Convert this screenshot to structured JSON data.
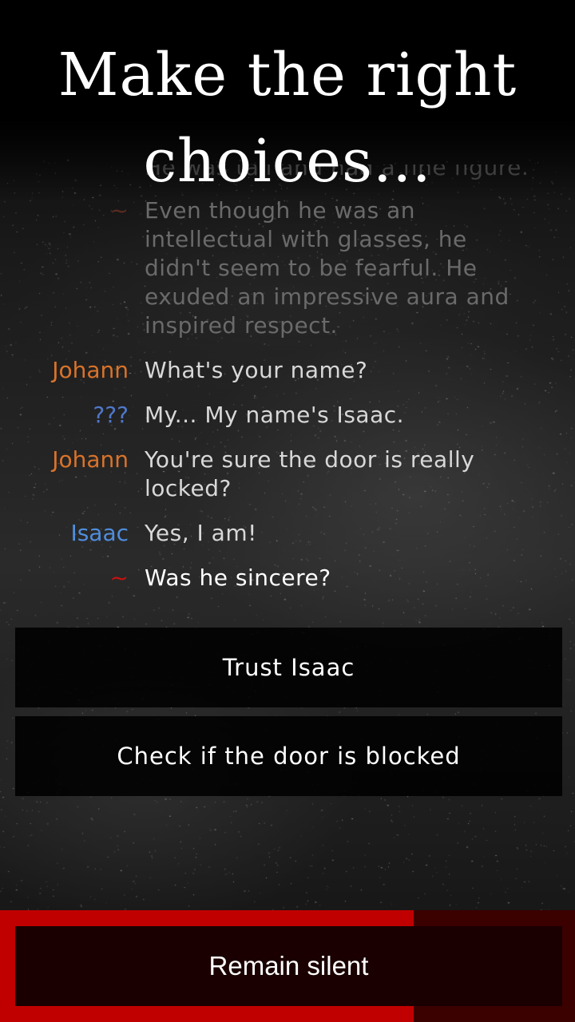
{
  "headline": {
    "line1": "Make the right",
    "line2": "choices..."
  },
  "dialogue": [
    {
      "speaker": "",
      "speaker_style": "narrator",
      "text": "He was tall and had a fine figure.",
      "state": "cut"
    },
    {
      "speaker": "~",
      "speaker_style": "narrator",
      "text": "Even though he was an intellectual with glasses, he didn't seem to be fearful. He exuded an impressive aura and inspired respect.",
      "state": "faded"
    },
    {
      "speaker": "Johann",
      "speaker_style": "johann",
      "text": "What's your name?",
      "state": "normal"
    },
    {
      "speaker": "???",
      "speaker_style": "unknown",
      "text": "My... My name's Isaac.",
      "state": "normal"
    },
    {
      "speaker": "Johann",
      "speaker_style": "johann",
      "text": "You're sure the door is really locked?",
      "state": "normal"
    },
    {
      "speaker": "Isaac",
      "speaker_style": "isaac",
      "text": "Yes, I am!",
      "state": "normal"
    },
    {
      "speaker": "~",
      "speaker_style": "narrator",
      "text": "Was he sincere?",
      "state": "current"
    }
  ],
  "choices": [
    {
      "label": "Trust Isaac"
    },
    {
      "label": "Check if the door is blocked"
    }
  ],
  "timer": {
    "label": "Remain silent",
    "remaining_fraction": 0.72,
    "fill_color": "#c00000",
    "track_color": "#3b0000"
  },
  "colors": {
    "narrator": "#c81010",
    "johann": "#d9732a",
    "unknown": "#4f78c8",
    "isaac": "#4f8ede"
  }
}
